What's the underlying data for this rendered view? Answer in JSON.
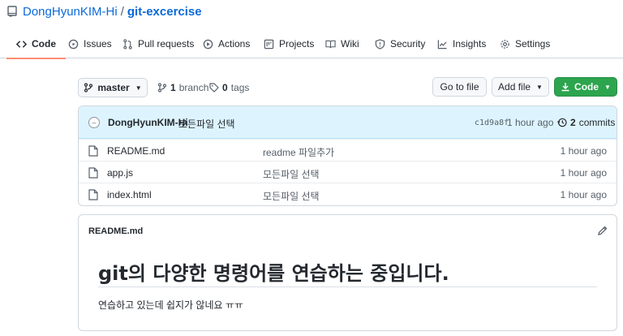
{
  "repo": {
    "owner": "DongHyunKIM-Hi",
    "separator": "/",
    "name": "git-excercise"
  },
  "tabs": [
    {
      "label": "Code",
      "icon": "code-icon",
      "active": true
    },
    {
      "label": "Issues",
      "icon": "issue-icon"
    },
    {
      "label": "Pull requests",
      "icon": "pull-request-icon"
    },
    {
      "label": "Actions",
      "icon": "play-icon"
    },
    {
      "label": "Projects",
      "icon": "project-icon"
    },
    {
      "label": "Wiki",
      "icon": "book-icon"
    },
    {
      "label": "Security",
      "icon": "shield-icon"
    },
    {
      "label": "Insights",
      "icon": "graph-icon"
    },
    {
      "label": "Settings",
      "icon": "gear-icon"
    }
  ],
  "toolbar": {
    "branch": "master",
    "branch_count": "1",
    "branch_label": "branch",
    "tag_count": "0",
    "tag_label": "tags",
    "goto_file": "Go to file",
    "add_file": "Add file",
    "code": "Code",
    "accent": "#2da44e"
  },
  "commit": {
    "author": "DongHyunKIM-Hi",
    "message": "모든파일 선택",
    "sha": "c1d9a8f",
    "time": "1 hour ago",
    "count": "2",
    "count_label": "commits"
  },
  "files": [
    {
      "name": "README.md",
      "message": "readme 파일추가",
      "age": "1 hour ago"
    },
    {
      "name": "app.js",
      "message": "모든파일 선택",
      "age": "1 hour ago"
    },
    {
      "name": "index.html",
      "message": "모든파일 선택",
      "age": "1 hour ago"
    }
  ],
  "readme": {
    "title": "README.md",
    "heading": "git의 다양한 명령어를 연습하는 중입니다.",
    "body": "연습하고 있는데 쉽지가 않네요 ㅠㅠ"
  }
}
